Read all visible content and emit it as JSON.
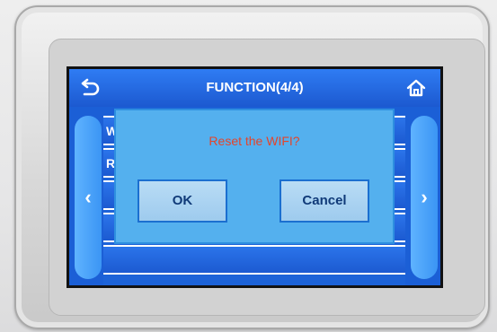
{
  "header": {
    "title": "FUNCTION(4/4)",
    "back_icon": "back-arrow-icon",
    "home_icon": "home-icon"
  },
  "nav": {
    "prev_glyph": "‹",
    "next_glyph": "›"
  },
  "list": {
    "items": [
      {
        "label": "W"
      },
      {
        "label": "Re"
      },
      {
        "label": ""
      },
      {
        "label": ""
      },
      {
        "label": ""
      }
    ]
  },
  "dialog": {
    "message": "Reset the WIFI?",
    "ok_label": "OK",
    "cancel_label": "Cancel"
  },
  "colors": {
    "screen_blue": "#1b5fd6",
    "dialog_blue": "#54b0ee",
    "message_red": "#e4452b"
  }
}
